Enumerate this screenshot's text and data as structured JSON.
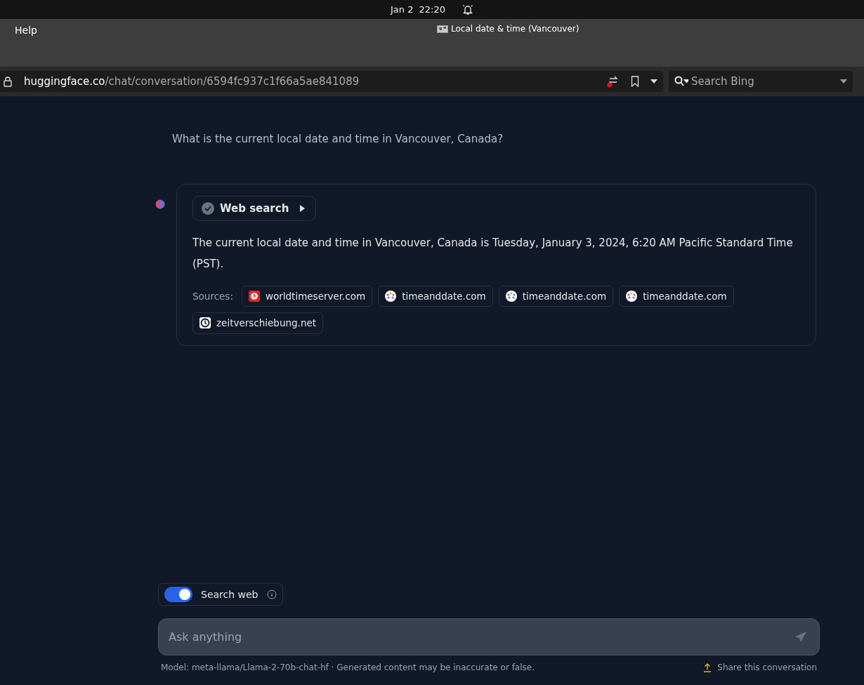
{
  "system_bar": {
    "date": "Jan 2",
    "time": "22:20"
  },
  "browser": {
    "menu": "Help",
    "tab_title": "Local date & time (Vancouver)",
    "url_domain": "huggingface.co",
    "url_path": "/chat/conversation/6594fc937c1f66a5ae841089",
    "search_placeholder": "Search Bing"
  },
  "user_message": "What is the current local date and time in Vancouver, Canada?",
  "assistant": {
    "web_search": {
      "label": "Web search",
      "expanded": false
    },
    "answer": "The current local date and time in Vancouver, Canada is Tuesday, January 3, 2024, 6:20 AM Pacific Standard Time (PST).",
    "sources_label": "Sources:",
    "sources": [
      {
        "kind": "worldtimeserver",
        "label": "worldtimeserver.com"
      },
      {
        "kind": "timeanddate",
        "label": "timeanddate.com"
      },
      {
        "kind": "timeanddate",
        "label": "timeanddate.com"
      },
      {
        "kind": "timeanddate",
        "label": "timeanddate.com"
      },
      {
        "kind": "zeitverschiebung",
        "label": "zeitverschiebung.net"
      }
    ]
  },
  "search_web": {
    "label": "Search web",
    "on": true
  },
  "composer": {
    "placeholder": "Ask anything"
  },
  "footer": {
    "model_note": "Model: meta-llama/Llama-2-70b-chat-hf · Generated content may be inaccurate or false.",
    "share": "Share this conversation"
  }
}
